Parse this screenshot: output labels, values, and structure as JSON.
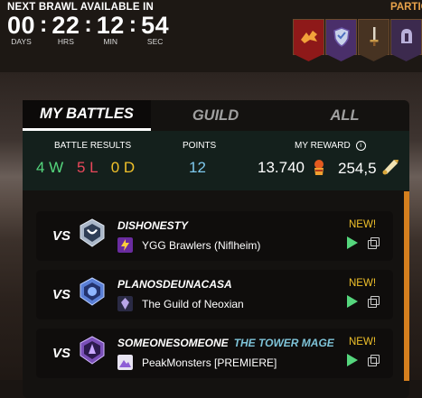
{
  "brawl_timer": {
    "label": "NEXT BRAWL AVAILABLE IN",
    "units": [
      {
        "value": "00",
        "label": "DAYS"
      },
      {
        "value": "22",
        "label": "HRS"
      },
      {
        "value": "12",
        "label": "MIN"
      },
      {
        "value": "54",
        "label": "SEC"
      }
    ],
    "separator": ":"
  },
  "participants_label": "PARTIC",
  "participant_banners": [
    "dragon-icon",
    "shield-icon",
    "sword-icon",
    "helmet-icon"
  ],
  "tabs": [
    {
      "label": "MY BATTLES",
      "active": true
    },
    {
      "label": "GUILD",
      "active": false
    },
    {
      "label": "ALL",
      "active": false
    }
  ],
  "stats": {
    "battle_results_label": "BATTLE RESULTS",
    "wins": "4 W",
    "losses": "5 L",
    "draws": "0 D",
    "points_label": "POINTS",
    "points": "12",
    "reward_label": "MY REWARD",
    "reward_merits": "13.740",
    "reward_sps": "254,5"
  },
  "battles": [
    {
      "vs": "VS",
      "opponent": "DISHONESTY",
      "title": "",
      "guild": "YGG Brawlers (Niflheim)",
      "new": "NEW!"
    },
    {
      "vs": "VS",
      "opponent": "PLANOSDEUNACASA",
      "title": "",
      "guild": "The Guild of Neoxian",
      "new": "NEW!"
    },
    {
      "vs": "VS",
      "opponent": "SOMEONESOMEONE",
      "title": "THE TOWER MAGE",
      "guild": "PeakMonsters [PREMIERE]",
      "new": "NEW!"
    }
  ],
  "colors": {
    "win": "#55d67d",
    "loss": "#e9475a",
    "draw": "#f0c12a",
    "points": "#7ec9ee",
    "new_badge": "#f0c12a",
    "accent_edge": "#d57f1e"
  }
}
